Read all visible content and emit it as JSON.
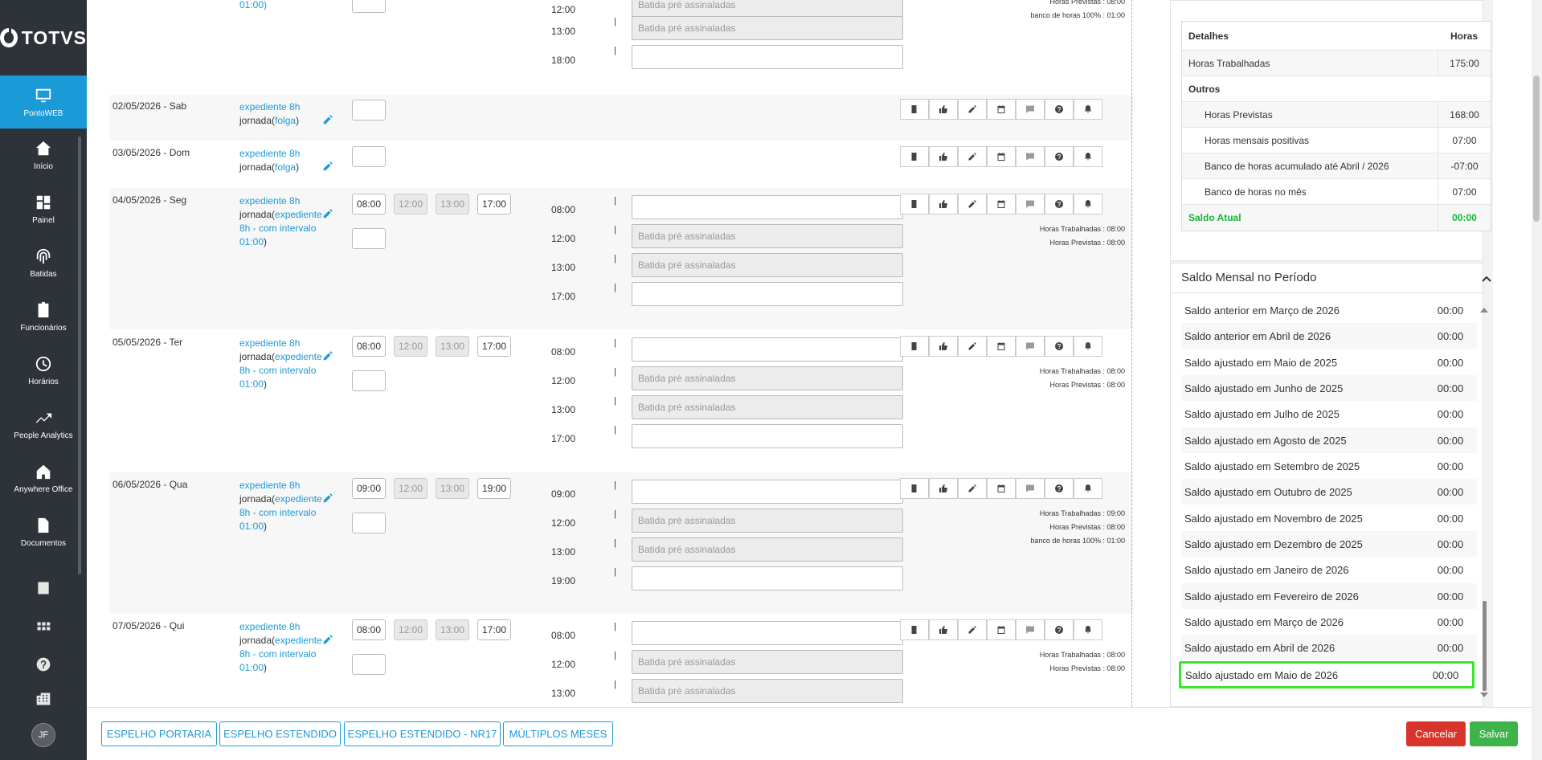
{
  "brand": {
    "name": "TOTVS"
  },
  "nav": {
    "active": "PontoWEB",
    "items": [
      "Início",
      "Painel",
      "Batidas",
      "Funcionários",
      "Horários",
      "People Analytics",
      "Anywhere Office",
      "Documentos"
    ],
    "avatar": "JF"
  },
  "top_partial": {
    "exp_partial": "01:00)",
    "times": [
      "12:00",
      "13:00",
      "18:00"
    ],
    "placeholders": [
      "Batida pré assinaladas",
      "Batida pré assinaladas"
    ],
    "summary": [
      "Horas Previstas : 08:00",
      "banco de horas 100% : 01:00"
    ]
  },
  "days": [
    {
      "date": "02/05/2026 - Sab",
      "exp1": "expediente 8h",
      "exp2": "jornada(",
      "exp_link": "folga",
      "exp_end": ")"
    },
    {
      "date": "03/05/2026 - Dom",
      "exp1": "expediente 8h",
      "exp2": "jornada(",
      "exp_link": "folga",
      "exp_end": ")"
    },
    {
      "date": "04/05/2026 - Seg",
      "exp1": "expediente 8h",
      "exp2": "jornada(",
      "exp_link": "expediente 8h - com intervalo 01:00",
      "exp_end": ")",
      "entrada": "08:00",
      "int1": "12:00",
      "int2": "13:00",
      "saida": "17:00",
      "batidas": [
        "08:00",
        "12:00",
        "13:00",
        "17:00"
      ],
      "summary": [
        "Horas Trabalhadas : 08:00",
        "Horas Previstas : 08:00"
      ]
    },
    {
      "date": "05/05/2026 - Ter",
      "exp1": "expediente 8h",
      "exp2": "jornada(",
      "exp_link": "expediente 8h - com intervalo 01:00",
      "exp_end": ")",
      "entrada": "08:00",
      "int1": "12:00",
      "int2": "13:00",
      "saida": "17:00",
      "batidas": [
        "08:00",
        "12:00",
        "13:00",
        "17:00"
      ],
      "summary": [
        "Horas Trabalhadas : 08:00",
        "Horas Previstas : 08:00"
      ]
    },
    {
      "date": "06/05/2026 - Qua",
      "exp1": "expediente 8h",
      "exp2": "jornada(",
      "exp_link": "expediente 8h - com intervalo 01:00",
      "exp_end": ")",
      "entrada": "09:00",
      "int1": "12:00",
      "int2": "13:00",
      "saida": "19:00",
      "batidas": [
        "09:00",
        "12:00",
        "13:00",
        "19:00"
      ],
      "summary": [
        "Horas Trabalhadas : 09:00",
        "Horas Previstas : 08:00",
        "banco de horas 100% : 01:00"
      ]
    },
    {
      "date": "07/05/2026 - Qui",
      "exp1": "expediente 8h",
      "exp2": "jornada(",
      "exp_link": "expediente 8h - com intervalo 01:00",
      "exp_end": ")",
      "entrada": "08:00",
      "int1": "12:00",
      "int2": "13:00",
      "saida": "17:00",
      "batidas": [
        "08:00",
        "12:00",
        "13:00"
      ],
      "summary": [
        "Horas Trabalhadas : 08:00",
        "Horas Previstas : 08:00"
      ]
    }
  ],
  "placeholder": "Batida pré assinaladas",
  "detalhes": {
    "header": [
      "Detalhes",
      "Horas"
    ],
    "rows": [
      {
        "label": "Horas Trabalhadas",
        "value": "175:00"
      },
      {
        "label": "Outros",
        "value": ""
      },
      {
        "label": "Horas Previstas",
        "value": "168:00"
      },
      {
        "label": "Horas mensais positivas",
        "value": "07:00"
      },
      {
        "label": "Banco de horas acumulado até Abril / 2026",
        "value": "-07:00"
      },
      {
        "label": "Banco de horas no mês",
        "value": "07:00"
      },
      {
        "label": "Saldo Atual",
        "value": "00:00"
      }
    ]
  },
  "saldo_mensal": {
    "title": "Saldo Mensal no Período",
    "rows": [
      {
        "label": "Saldo anterior em Março de 2026",
        "value": "00:00"
      },
      {
        "label": "Saldo anterior em Abril de 2026",
        "value": "00:00"
      },
      {
        "label": "Saldo ajustado em Maio de 2025",
        "value": "00:00"
      },
      {
        "label": "Saldo ajustado em Junho de 2025",
        "value": "00:00"
      },
      {
        "label": "Saldo ajustado em Julho de 2025",
        "value": "00:00"
      },
      {
        "label": "Saldo ajustado em Agosto de 2025",
        "value": "00:00"
      },
      {
        "label": "Saldo ajustado em Setembro de 2025",
        "value": "00:00"
      },
      {
        "label": "Saldo ajustado em Outubro de 2025",
        "value": "00:00"
      },
      {
        "label": "Saldo ajustado em Novembro de 2025",
        "value": "00:00"
      },
      {
        "label": "Saldo ajustado em Dezembro de 2025",
        "value": "00:00"
      },
      {
        "label": "Saldo ajustado em Janeiro de 2026",
        "value": "00:00"
      },
      {
        "label": "Saldo ajustado em Fevereiro de 2026",
        "value": "00:00"
      },
      {
        "label": "Saldo ajustado em Março de 2026",
        "value": "00:00"
      },
      {
        "label": "Saldo ajustado em Abril de 2026",
        "value": "00:00"
      },
      {
        "label": "Saldo ajustado em Maio de 2026",
        "value": "00:00"
      }
    ]
  },
  "footer": {
    "buttons": [
      "ESPELHO PORTARIA",
      "ESPELHO ESTENDIDO",
      "ESPELHO ESTENDIDO - NR17",
      "MÚLTIPLOS MESES"
    ],
    "cancel": "Cancelar",
    "save": "Salvar"
  },
  "colors": {
    "accent": "#1a9ad6",
    "sidebar": "#2e3239",
    "highlight": "#39e631",
    "cancel": "#d9342b",
    "save": "#3cb44a",
    "saldo_atual": "#16b43a"
  }
}
